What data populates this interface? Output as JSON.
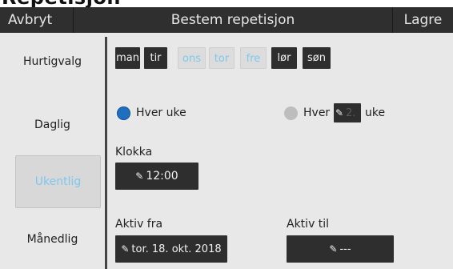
{
  "clipped_title": "Repetisjon",
  "header": {
    "cancel": "Avbryt",
    "title": "Bestem repetisjon",
    "save": "Lagre"
  },
  "sidebar": {
    "items": [
      "Hurtigvalg",
      "Daglig",
      "Ukentlig",
      "Månedlig"
    ],
    "selected": "Ukentlig"
  },
  "days": [
    {
      "label": "man",
      "selected": false
    },
    {
      "label": "tir",
      "selected": false
    },
    {
      "label": "ons",
      "selected": true
    },
    {
      "label": "tor",
      "selected": true
    },
    {
      "label": "fre",
      "selected": true
    },
    {
      "label": "lør",
      "selected": false
    },
    {
      "label": "søn",
      "selected": false
    }
  ],
  "repeat": {
    "every_week": "Hver uke",
    "every_nth_prefix": "Hver",
    "every_nth_value": "2.",
    "every_nth_suffix": "uke",
    "selected": "every_week"
  },
  "time": {
    "label": "Klokka",
    "value": "12:00"
  },
  "active_from": {
    "label": "Aktiv fra",
    "value": "tor. 18. okt. 2018"
  },
  "active_to": {
    "label": "Aktiv til",
    "value": "---"
  },
  "colors": {
    "accent": "#7ec8ee",
    "radio_selected": "#1f6fbf",
    "radio_unselected": "#bdbdbd",
    "dark": "#2e2e2e"
  },
  "icons": {
    "edit": "pencil-edit-icon"
  }
}
